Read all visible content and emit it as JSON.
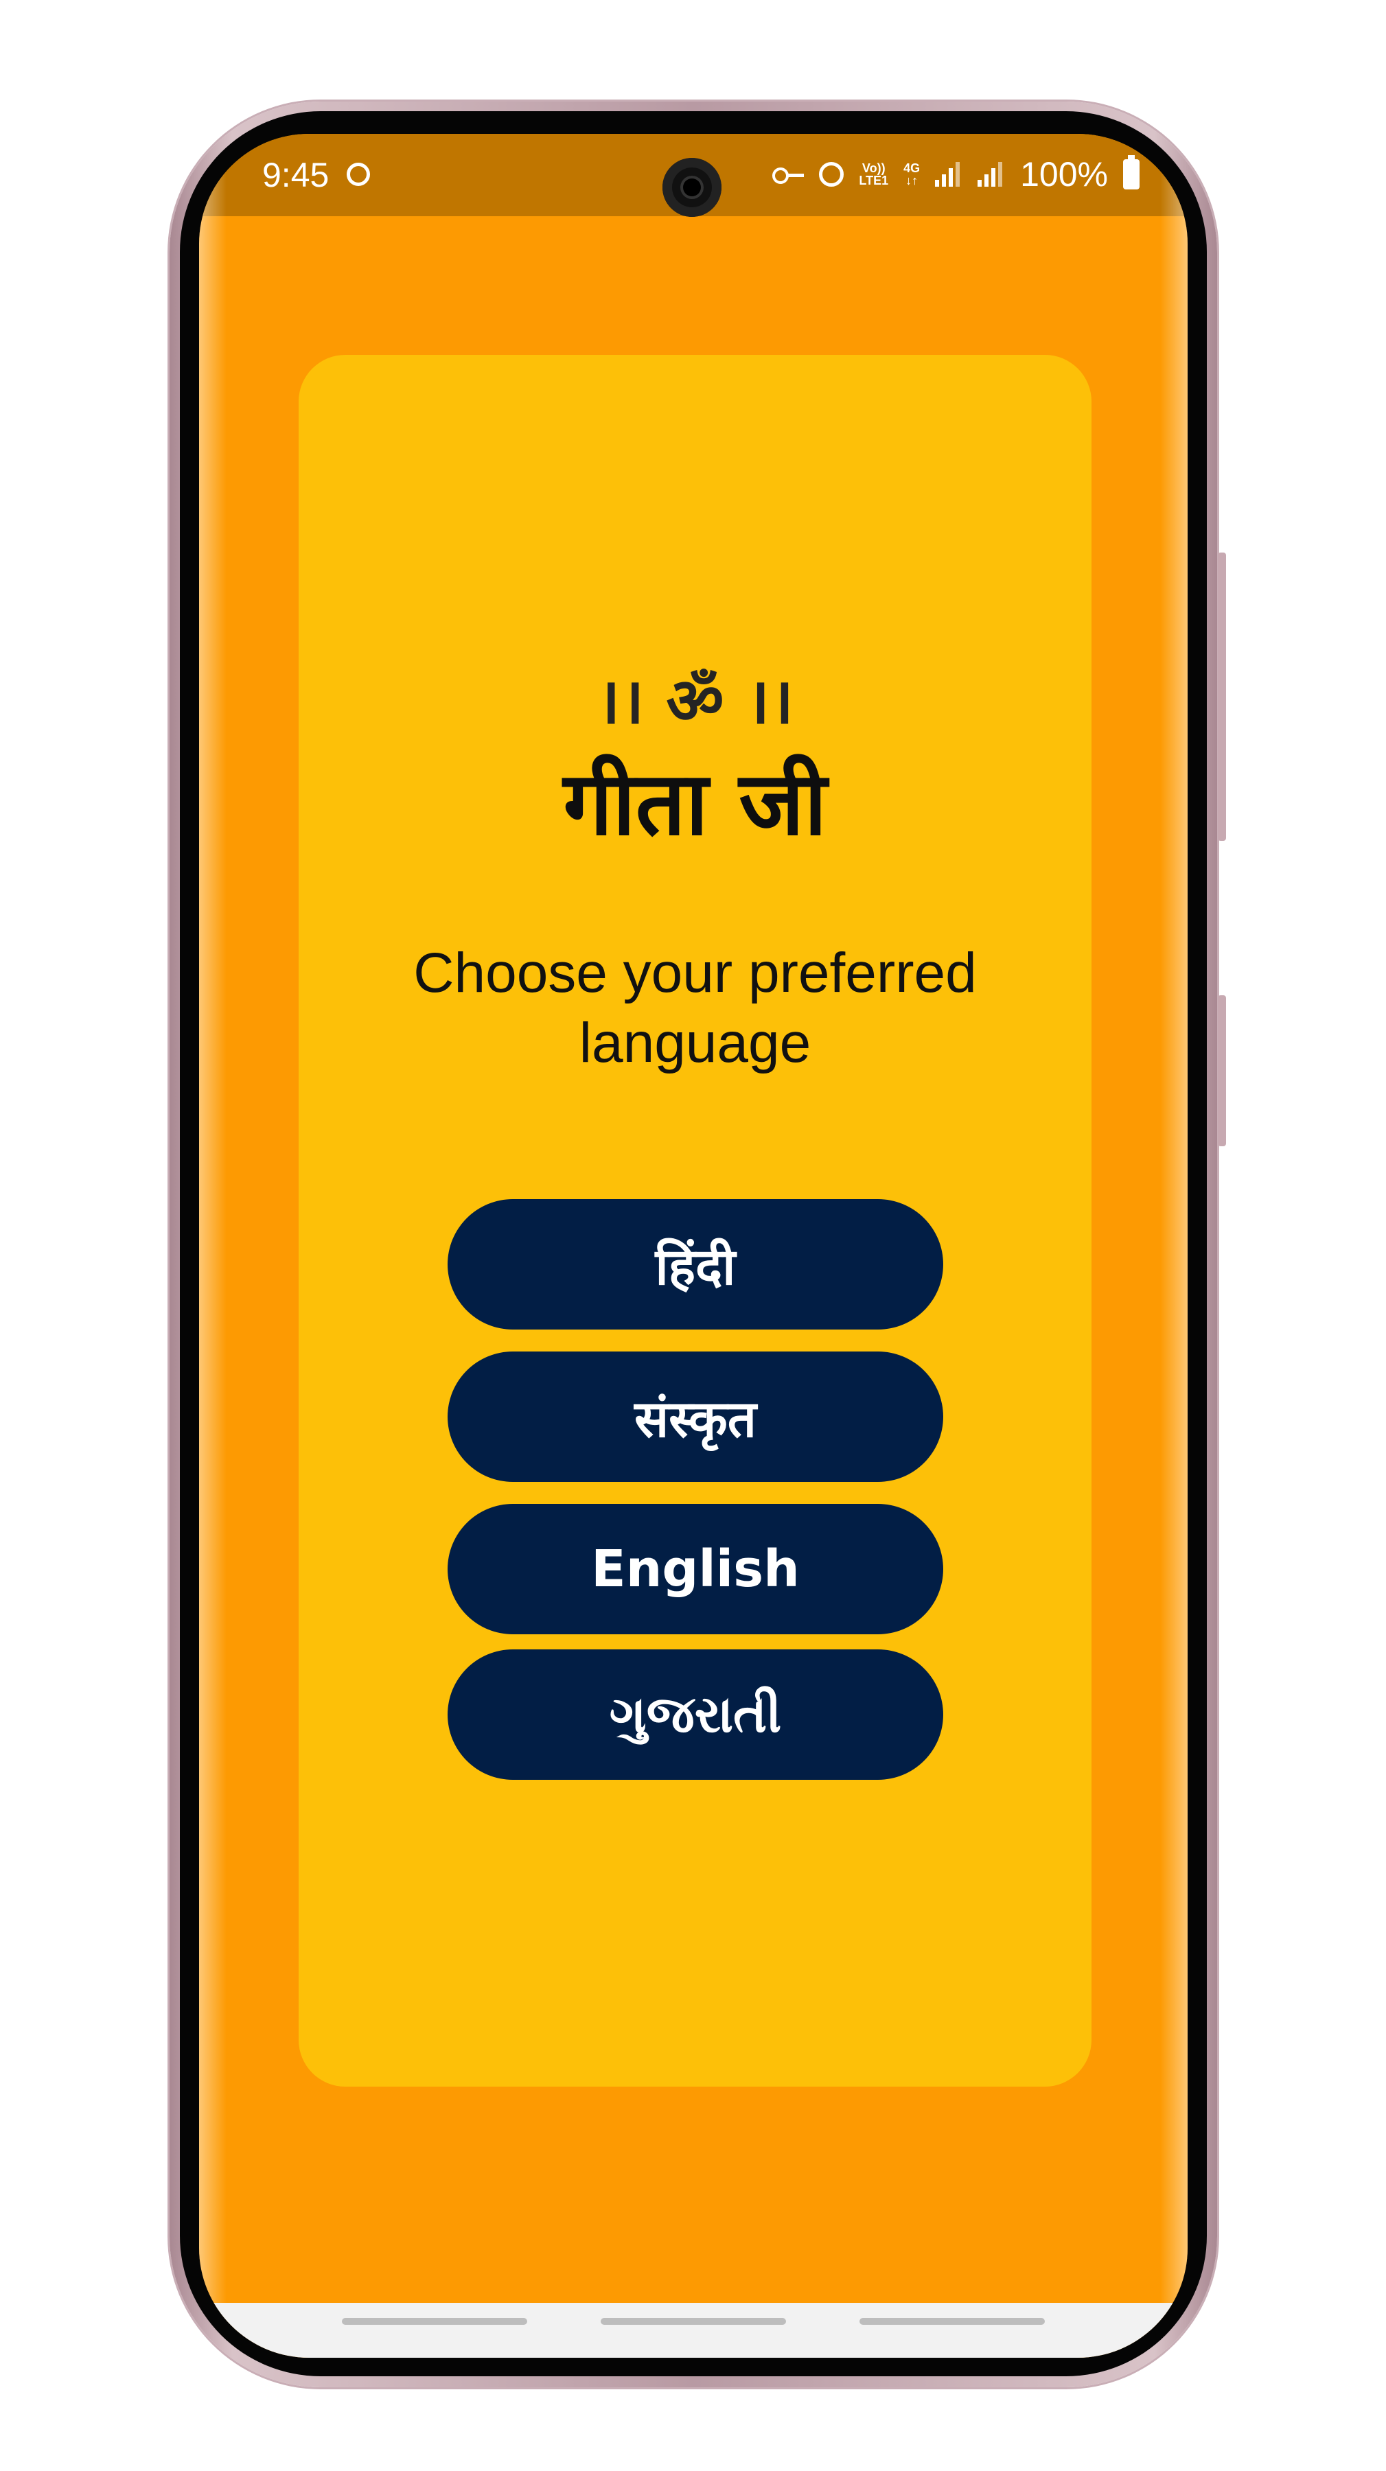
{
  "status_bar": {
    "time": "9:45",
    "battery_percent": "100%",
    "volte_top": "Vo))",
    "volte_bottom": "LTE1",
    "network_top": "4G",
    "network_bottom": "↓↑",
    "icons": [
      "notification-icon",
      "key-icon",
      "alarm-icon",
      "volte-icon",
      "4g-icon",
      "signal-icon",
      "signal-icon",
      "battery-icon"
    ]
  },
  "main": {
    "om_line": "।। ॐ ।।",
    "title": "गीता जी",
    "prompt": "Choose your preferred language",
    "languages": [
      {
        "label": "हिंदी"
      },
      {
        "label": "संस्कृत"
      },
      {
        "label": "English"
      },
      {
        "label": "ગુજરાતી"
      }
    ]
  },
  "colors": {
    "background": "#fd9a02",
    "card": "#fdc008",
    "button": "#021e45",
    "status_bar": "#c07600"
  }
}
